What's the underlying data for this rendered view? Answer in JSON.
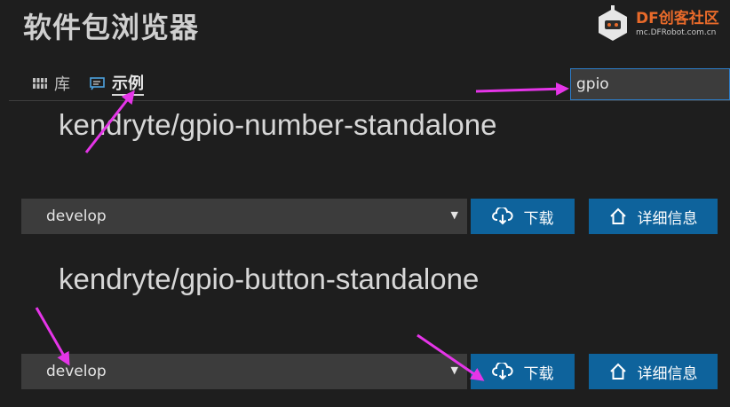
{
  "header": {
    "title": "软件包浏览器",
    "logo": {
      "brand": "DF",
      "brand_cn": "创客社区",
      "url": "mc.DFRobot.com.cn"
    }
  },
  "tabs": [
    {
      "label": "库",
      "icon": "library-icon",
      "active": false
    },
    {
      "label": "示例",
      "icon": "example-icon",
      "active": true
    }
  ],
  "search": {
    "value": "gpio"
  },
  "packages": [
    {
      "name": "kendryte/gpio-number-standalone",
      "version": "develop",
      "download_label": "下载",
      "details_label": "详细信息"
    },
    {
      "name": "kendryte/gpio-button-standalone",
      "version": "develop",
      "download_label": "下载",
      "details_label": "详细信息"
    }
  ],
  "colors": {
    "background": "#1e1e1e",
    "button": "#0e639c",
    "annotation_arrow": "#e535e8",
    "logo_accent": "#e86a2a"
  }
}
